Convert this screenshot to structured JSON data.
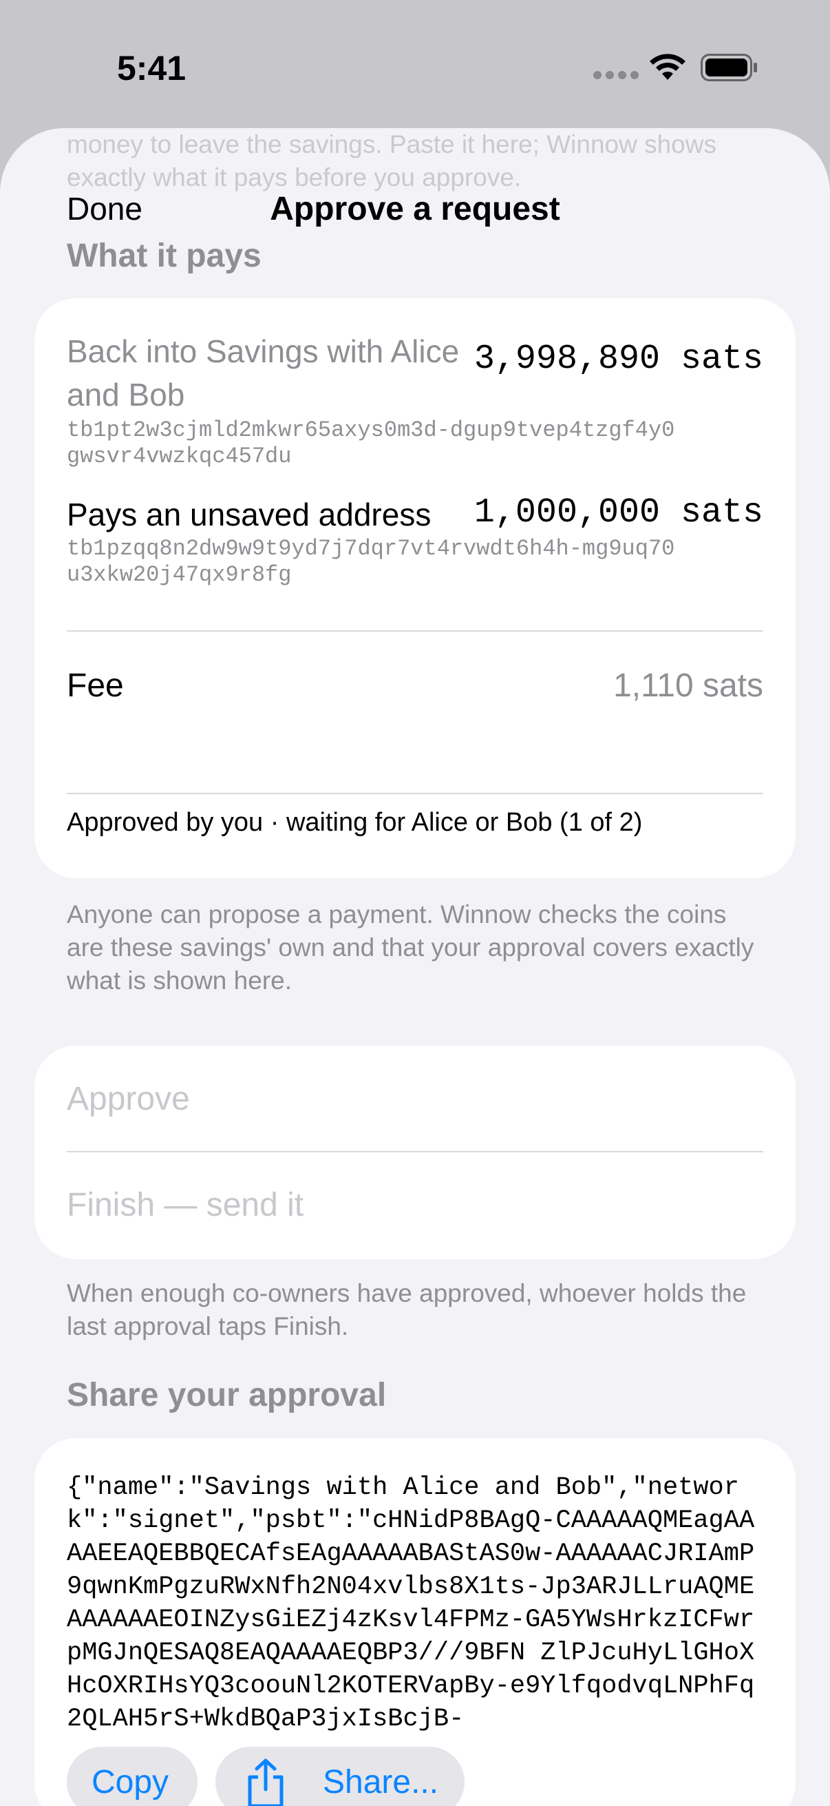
{
  "status_bar": {
    "time": "5:41"
  },
  "sheet": {
    "intro_faded": "money to leave the savings. Paste it here; Winnow shows exactly what it pays before you approve.",
    "nav": {
      "done_label": "Done",
      "title": "Approve a request"
    }
  },
  "what_it_pays": {
    "header": "What it pays",
    "outputs": [
      {
        "label": "Back into Savings with Alice and Bob",
        "amount": "3,998,890 sats",
        "address": "tb1pt2w3cjmld2mkwr65axys0m3d-dgup9tvep4tzgf4y0gwsvr4vwzkqc457du"
      },
      {
        "label": "Pays an unsaved address",
        "amount": "1,000,000 sats",
        "address": "tb1pzqq8n2dw9w9t9yd7j7dqr7vt4rvwdt6h4h-mg9uq70u3xkw20j47qx9r8fg"
      }
    ],
    "fee": {
      "label": "Fee",
      "value": "1,110 sats"
    },
    "approval_status": "Approved by you · waiting for Alice or Bob (1 of 2)",
    "footnote": "Anyone can propose a payment. Winnow checks the coins are these savings' own and that your approval covers exactly what is shown here."
  },
  "actions": {
    "approve_label": "Approve",
    "finish_label": "Finish — send it",
    "footnote": "When enough co-owners have approved, whoever holds the last approval taps Finish."
  },
  "share": {
    "header": "Share your approval",
    "json_text": "{\"name\":\"Savings with Alice and Bob\",\"network\":\"signet\",\"psbt\":\"cHNidP8BAgQ-CAAAAAQMEagAAAAEEAQEBBQECAfsEAgAAAAABAStAS0w-AAAAAACJRIAmP9qwnKmPgzuRWxNfh2N04xvlbs8X1ts-Jp3ARJLLruAQMEAAAAAAEOINZysGiEZj4zKsvl4FPMz-GA5YWsHrkzICFwrpMGJnQESAQ8EAQAAAAEQBP3///9BFN ZlPJcuHyLlGHoXHcOXRIHsYQ3coouNl2KOTERVapBy-e9YlfqodvqLNPhFq2QLAH5rS+WkdBQaP3jxIsBcjB-",
    "copy_label": "Copy",
    "share_label": "Share..."
  },
  "colors": {
    "accent": "#0a84ff",
    "secondary_text": "#8e8e93",
    "sheet_background": "#f2f2f7"
  }
}
